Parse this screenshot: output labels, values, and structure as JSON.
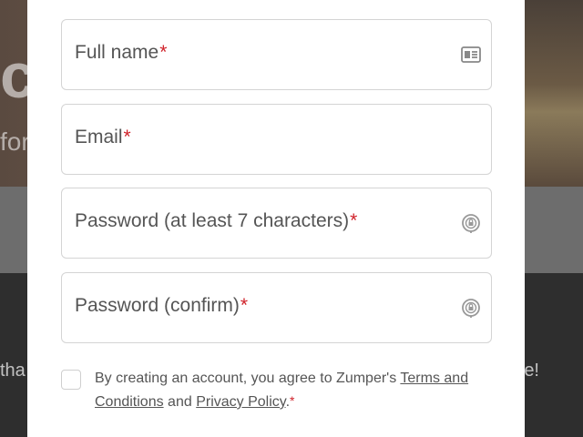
{
  "background": {
    "hero_letter": "c",
    "hero_sub": "for",
    "left_text": "tha",
    "right_text": "e!"
  },
  "form": {
    "full_name": {
      "label": "Full name",
      "required_mark": "*",
      "icon": "contact-card-icon"
    },
    "email": {
      "label": "Email",
      "required_mark": "*"
    },
    "password": {
      "label": "Password (at least 7 characters)",
      "required_mark": "*",
      "icon": "password-lock-icon"
    },
    "password_confirm": {
      "label": "Password (confirm)",
      "required_mark": "*",
      "icon": "password-lock-icon"
    }
  },
  "terms": {
    "prefix": "By creating an account, you agree to Zumper's ",
    "terms_link": "Terms and Conditions",
    "middle": " and ",
    "privacy_link": "Privacy Policy",
    "suffix": ".",
    "required_mark": "*",
    "checked": false
  },
  "colors": {
    "required": "#d0222a",
    "text": "#555555",
    "border": "#d4d4d4"
  }
}
